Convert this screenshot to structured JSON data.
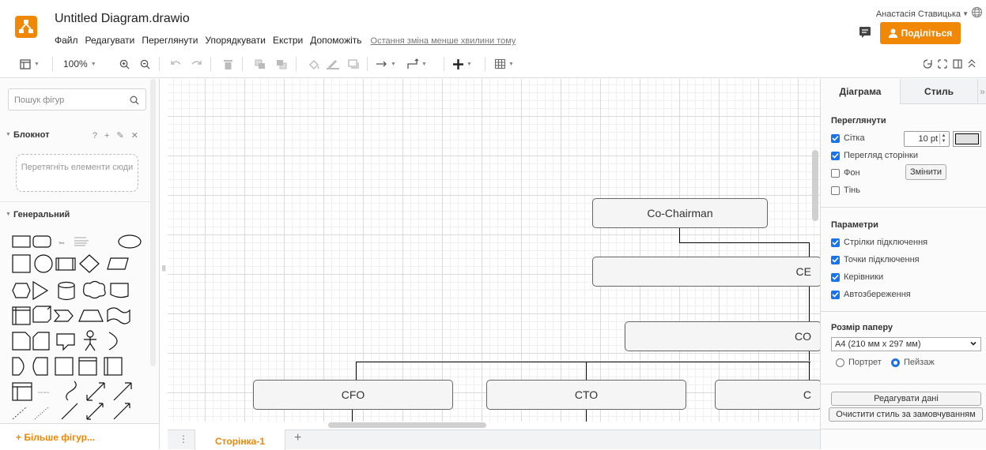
{
  "app": {
    "title": "Untitled Diagram.drawio",
    "menu": [
      "Файл",
      "Редагувати",
      "Переглянути",
      "Упорядкувати",
      "Екстри",
      "Допоможіть"
    ],
    "last_change": "Остання зміна менше хвилини тому",
    "user_name": "Анастасія Ставицька",
    "share_label": "Поділіться",
    "brand_color": "#f08705"
  },
  "toolbar": {
    "zoom": "100%",
    "icons": [
      "view-panels-icon",
      "zoom-in-icon",
      "zoom-out-icon",
      "undo-icon",
      "redo-icon",
      "delete-icon",
      "to-front-icon",
      "to-back-icon",
      "fill-color-icon",
      "line-color-icon",
      "shadow-icon",
      "connection-icon",
      "waypoints-icon",
      "insert-icon",
      "table-icon",
      "collapse-icon"
    ]
  },
  "sidebar": {
    "search_placeholder": "Пошук фігур",
    "scratchpad_title": "Блокнот",
    "scratchpad_actions": "? + ✎ ✕",
    "dropzone_text": "Перетягніть елементи сюди",
    "general_title": "Генеральний",
    "more_shapes": "+ Більше фігур..."
  },
  "diagram": {
    "nodes": [
      "Co-Chairman",
      "CE",
      "CO",
      "CFO",
      "CTO",
      "C"
    ]
  },
  "pages": {
    "tabs": [
      "Сторінка-1"
    ]
  },
  "format_panel": {
    "tabs": [
      "Діаграма",
      "Стиль"
    ],
    "view_title": "Переглянути",
    "grid_label": "Сітка",
    "grid_size": "10 pt",
    "page_view_label": "Перегляд сторінки",
    "background_label": "Фон",
    "change_button": "Змінити",
    "shadow_label": "Тінь",
    "options_title": "Параметри",
    "options": [
      "Стрілки підключення",
      "Точки підключення",
      "Керівники",
      "Автозбереження"
    ],
    "paper_title": "Розмір паперу",
    "paper_size": "A4 (210 мм x 297 мм)",
    "orientation": [
      "Портрет",
      "Пейзаж"
    ],
    "edit_data_button": "Редагувати дані",
    "clear_style_button": "Очистити стиль за замовчуванням",
    "checkbox_color": "#1a73e8"
  }
}
